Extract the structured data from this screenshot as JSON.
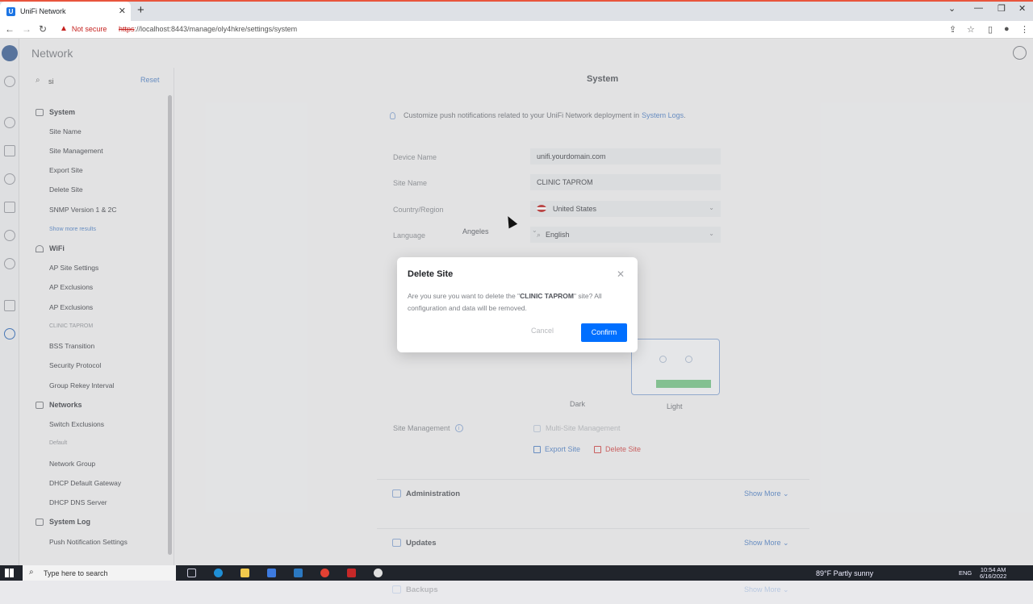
{
  "browser": {
    "tab_title": "UniFi Network",
    "tab_favicon": "U",
    "new_tab": "+",
    "security_label": "Not secure",
    "url_scheme": "https",
    "url_rest": "://localhost:8443/manage/oly4hkre/settings/system"
  },
  "app": {
    "title": "Network"
  },
  "sidebar": {
    "search_value": "si",
    "reset_label": "Reset",
    "system": {
      "label": "System",
      "items": [
        "Site Name",
        "Site Management",
        "Export Site",
        "Delete Site",
        "SNMP Version 1 & 2C"
      ],
      "show_more": "Show more results"
    },
    "wifi": {
      "label": "WiFi",
      "items": [
        "AP Site Settings",
        "AP Exclusions",
        "AP Exclusions"
      ],
      "group_label": "CLINIC TAPROM",
      "items2": [
        "BSS Transition",
        "Security Protocol",
        "Group Rekey Interval"
      ]
    },
    "networks": {
      "label": "Networks",
      "items": [
        "Switch Exclusions"
      ],
      "group_label": "Default",
      "items2": [
        "Network Group",
        "DHCP Default Gateway",
        "DHCP DNS Server"
      ]
    },
    "syslog": {
      "label": "System Log",
      "items": [
        "Push Notification Settings"
      ]
    }
  },
  "main": {
    "title": "System",
    "notice_text": "Customize push notifications related to your UniFi Network deployment in",
    "notice_link": "System Logs",
    "notice_end": ".",
    "fields": {
      "device_name_label": "Device Name",
      "device_name_value": "unifi.yourdomain.com",
      "site_name_label": "Site Name",
      "site_name_value": "CLINIC TAPROM",
      "country_label": "Country/Region",
      "country_value": "United States",
      "language_label": "Language",
      "language_value": "English",
      "timezone_partial": "Angeles"
    },
    "theme_dark_label": "Dark",
    "theme_light_label": "Light",
    "site_mgmt_label": "Site Management",
    "multisite_label": "Multi-Site Management",
    "export_site": "Export Site",
    "delete_site": "Delete Site",
    "panels": [
      {
        "title": "Administration",
        "more": "Show More"
      },
      {
        "title": "Updates",
        "more": "Show More"
      },
      {
        "title": "Backups",
        "more": "Show More"
      }
    ]
  },
  "modal": {
    "title": "Delete Site",
    "msg_before": "Are you sure you want to delete the \"",
    "msg_site": "CLINIC TAPROM",
    "msg_after": "\" site? All configuration and data will be removed.",
    "cancel": "Cancel",
    "confirm": "Confirm"
  },
  "taskbar": {
    "search_placeholder": "Type here to search",
    "weather": "89°F  Partly sunny",
    "lang": "ENG",
    "time": "10:54 AM",
    "date": "6/16/2022"
  },
  "colors": {
    "primary": "#006fff",
    "danger": "#d96464",
    "link": "#6e97d0"
  }
}
